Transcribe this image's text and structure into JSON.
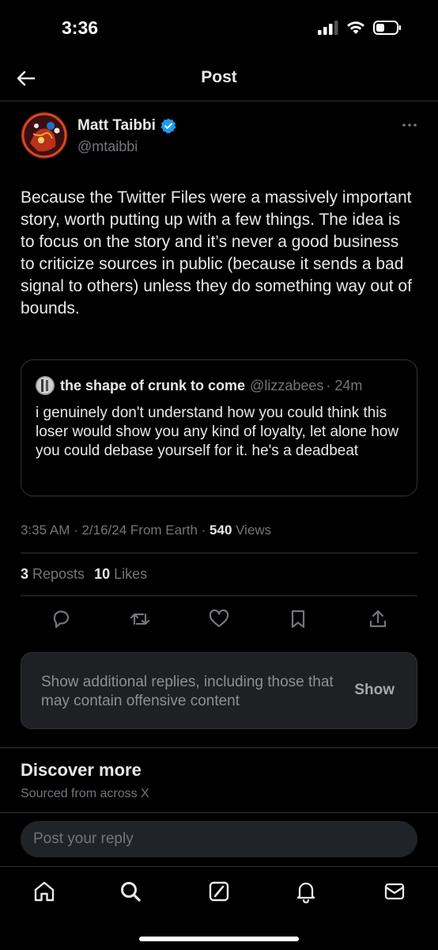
{
  "status_bar": {
    "time": "3:36"
  },
  "header": {
    "title": "Post"
  },
  "tweet": {
    "author_name": "Matt Taibbi",
    "author_handle": "@mtaibbi",
    "text": "Because the Twitter Files were a massively important story, worth putting up with a few things. The idea is to focus on the story and it’s never a good business to criticize sources in public (because it sends a bad signal to others) unless they do something way out of bounds.",
    "quote": {
      "name": "the shape of crunk to come",
      "handle": "@lizzabees",
      "time": "· 24m",
      "text": "i genuinely don't understand how you could think this loser would show you any kind of loyalty, let alone how you could debase yourself for it. he's a deadbeat"
    },
    "meta": {
      "time_date": "3:35 AM · 2/16/24 From Earth · ",
      "views_count": "540",
      "views_label": " Views"
    },
    "stats": {
      "reposts_count": "3",
      "reposts_label": " Reposts",
      "likes_count": "10",
      "likes_label": " Likes"
    }
  },
  "offensive_notice": {
    "text": "Show additional replies, including those that may contain offensive content",
    "button": "Show"
  },
  "discover": {
    "title": "Discover more",
    "subtitle": "Sourced from across X"
  },
  "reply": {
    "placeholder": "Post your reply"
  },
  "colors": {
    "verified": "#1d9bf0",
    "background": "#000000",
    "muted": "#71767b"
  }
}
